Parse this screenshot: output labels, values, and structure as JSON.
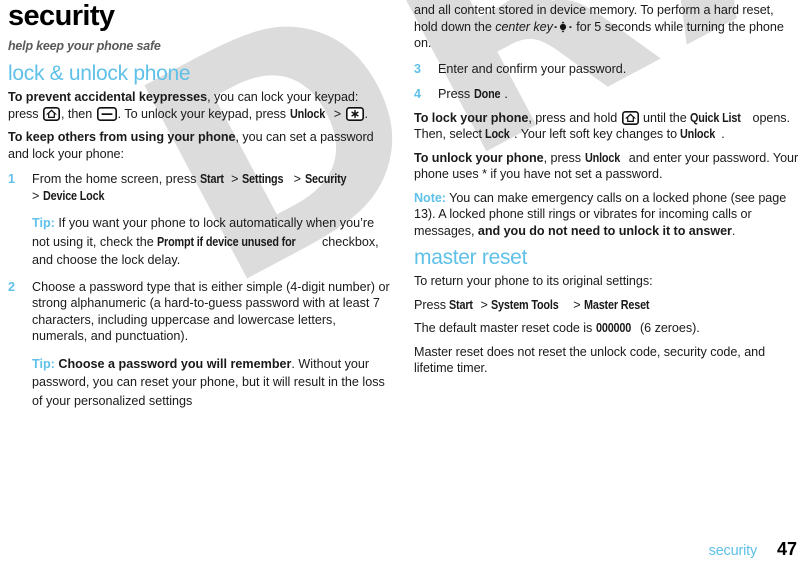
{
  "page": {
    "chapter_title": "security",
    "chapter_subtitle": "help keep your phone safe",
    "watermark": "DRAFT",
    "accent_color": "#5fc0e8",
    "footer": {
      "label": "security",
      "page_number": "47"
    }
  },
  "left_column": {
    "section_heading": "lock & unlock phone",
    "para_keypresses": {
      "lead": "To prevent accidental keypresses",
      "text_a": ", you can lock your keypad: press ",
      "icon_home": "home-key-icon",
      "text_b": ", then ",
      "icon_softkey": "soft-key-icon",
      "text_c": ". To unlock your keypad, press ",
      "ui_unlock": "Unlock",
      "text_d": " > ",
      "icon_star": "star-key-icon",
      "text_e": "."
    },
    "para_keep_others": {
      "lead": "To keep others from using your phone",
      "text": ", you can set a password and lock your phone:"
    },
    "steps": [
      {
        "num": "1",
        "text_a": "From the home screen, press ",
        "ui_1": "Start",
        "sep_1": " > ",
        "ui_2": "Settings",
        "sep_2": " > ",
        "ui_3": "Security",
        "sep_3": " > ",
        "ui_4": "Device Lock",
        "tip": {
          "label": "Tip:",
          "text_a": " If you want your phone to lock automatically when you’re not using it, check the ",
          "ui": "Prompt if device unused for",
          "text_b": " checkbox, and choose the lock delay."
        }
      },
      {
        "num": "2",
        "text": "Choose a password type that is either simple (4-digit number) or strong alphanumeric (a hard-to-guess password with at least 7 characters, including uppercase and lowercase letters, numerals, and punctuation).",
        "tip": {
          "label": "Tip:",
          "bold": " Choose a password you will remember",
          "text": ". Without your password, you can reset your phone, but it will result in the loss of your personalized settings"
        }
      }
    ]
  },
  "right_column": {
    "continuation": {
      "text_a": "and all content stored in device memory. To perform a hard reset, hold down the ",
      "italic": "center key",
      "icon_center": "center-key-icon",
      "text_b": " for 5 seconds while turning the phone on."
    },
    "steps": [
      {
        "num": "3",
        "text": "Enter and confirm your password."
      },
      {
        "num": "4",
        "text_a": "Press ",
        "ui": "Done",
        "text_b": "."
      }
    ],
    "para_lock": {
      "lead": "To lock your phone",
      "text_a": ", press and hold ",
      "icon_home": "home-key-icon",
      "text_b": " until the ",
      "ui_quicklist": "Quick List",
      "text_c": " opens. Then, select ",
      "ui_lock": "Lock",
      "text_d": ". Your left soft key changes to ",
      "ui_unlock": "Unlock",
      "text_e": "."
    },
    "para_unlock": {
      "lead": "To unlock your phone",
      "text_a": ", press ",
      "ui_unlock": "Unlock",
      "text_b": " and enter your password. Your phone uses * if you have not set a password."
    },
    "note": {
      "label": "Note:",
      "text_a": " You can make emergency calls on a locked phone (see page 13). A locked phone still rings or vibrates for incoming calls or messages, ",
      "bold": "and you do not need to unlock it to answer",
      "text_b": "."
    },
    "section_heading": "master reset",
    "para_return": "To return your phone to its original settings:",
    "para_press": {
      "text_a": "Press ",
      "ui_1": "Start",
      "sep_1": " > ",
      "ui_2": "System Tools",
      "sep_2": " > ",
      "ui_3": "Master Reset"
    },
    "para_default_code": {
      "text_a": "The default master reset code is ",
      "code": "000000",
      "text_b": " (6 zeroes)."
    },
    "para_not_reset": "Master reset does not reset the unlock code, security code, and lifetime timer."
  }
}
